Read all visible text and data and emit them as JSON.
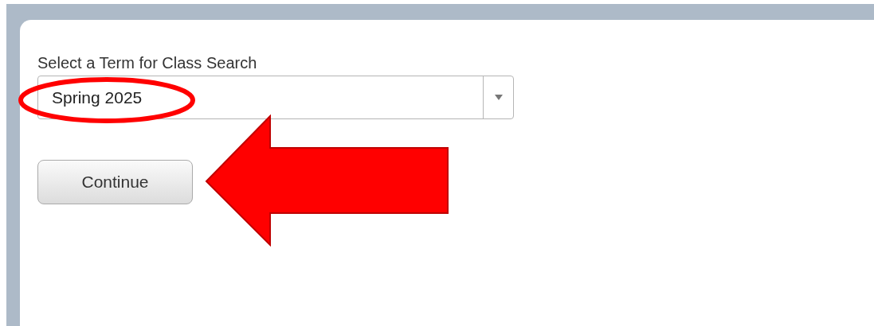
{
  "term_select": {
    "label": "Select a Term for Class Search",
    "value": "Spring 2025"
  },
  "continue_button": {
    "label": "Continue"
  }
}
